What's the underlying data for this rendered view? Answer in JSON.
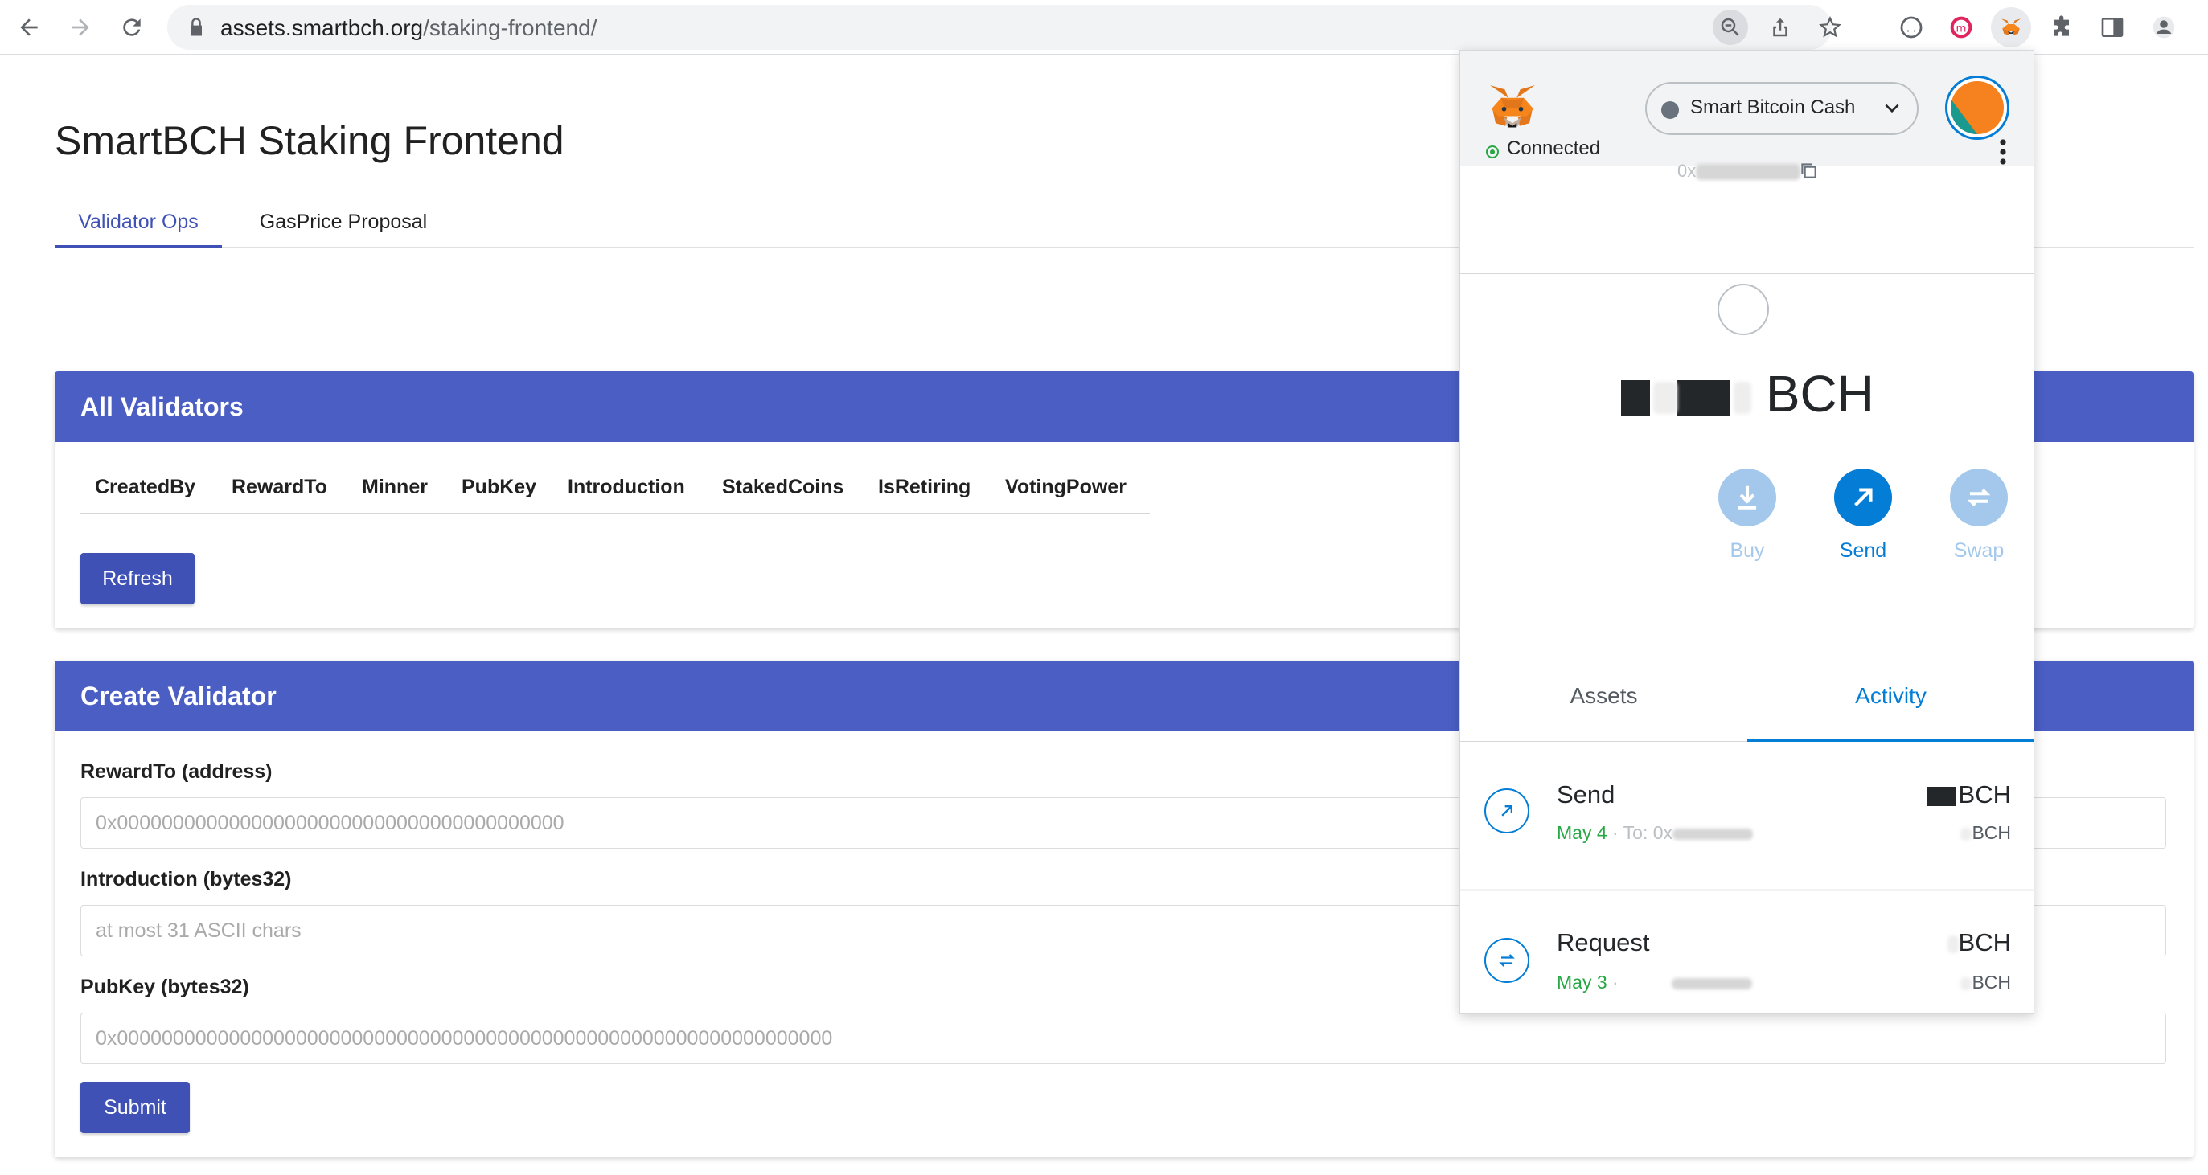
{
  "browser": {
    "url_host": "assets.smartbch.org",
    "url_path": "/staking-frontend/",
    "icons": [
      "back-icon",
      "forward-icon",
      "reload-icon",
      "lock-icon",
      "zoom-icon",
      "share-icon",
      "star-icon",
      "extension-icon",
      "metamask-icon",
      "puzzle-icon",
      "sidepanel-icon",
      "profile-icon"
    ]
  },
  "page": {
    "title": "SmartBCH Staking Frontend",
    "tabs": [
      {
        "label": "Validator Ops",
        "active": true
      },
      {
        "label": "GasPrice Proposal",
        "active": false
      }
    ]
  },
  "all_validators": {
    "title": "All Validators",
    "columns": [
      "CreatedBy",
      "RewardTo",
      "Minner",
      "PubKey",
      "Introduction",
      "StakedCoins",
      "IsRetiring",
      "VotingPower"
    ],
    "refresh_label": "Refresh"
  },
  "create_validator": {
    "title": "Create Validator",
    "fields": [
      {
        "label": "RewardTo (address)",
        "placeholder": "0x0000000000000000000000000000000000000000"
      },
      {
        "label": "Introduction (bytes32)",
        "placeholder": "at most 31 ASCII chars"
      },
      {
        "label": "PubKey (bytes32)",
        "placeholder": "0x0000000000000000000000000000000000000000000000000000000000000000"
      }
    ],
    "submit_label": "Submit"
  },
  "metamask": {
    "network": "Smart Bitcoin Cash",
    "connection_status": "Connected",
    "address_prefix": "0x",
    "balance_unit": "BCH",
    "actions": [
      {
        "label": "Buy",
        "icon": "download-icon",
        "enabled": false
      },
      {
        "label": "Send",
        "icon": "arrow-up-right-icon",
        "enabled": true
      },
      {
        "label": "Swap",
        "icon": "swap-icon",
        "enabled": false
      }
    ],
    "tabs": [
      {
        "label": "Assets",
        "active": false
      },
      {
        "label": "Activity",
        "active": true
      }
    ],
    "transactions": [
      {
        "title": "Send",
        "date": "May 4",
        "detail": "To: 0x",
        "amount_unit": "BCH",
        "fiat_unit": "BCH",
        "icon": "send-arrow-icon"
      },
      {
        "title": "Request",
        "date": "May 3",
        "detail": "",
        "amount_unit": "BCH",
        "fiat_unit": "BCH",
        "icon": "request-swap-icon"
      }
    ],
    "colors": {
      "accent": "#037dd6",
      "success": "#28a745",
      "header_bg": "#f2f3f4"
    }
  },
  "colors": {
    "primary": "#3f51b5",
    "card_header": "#4a5ec4"
  }
}
